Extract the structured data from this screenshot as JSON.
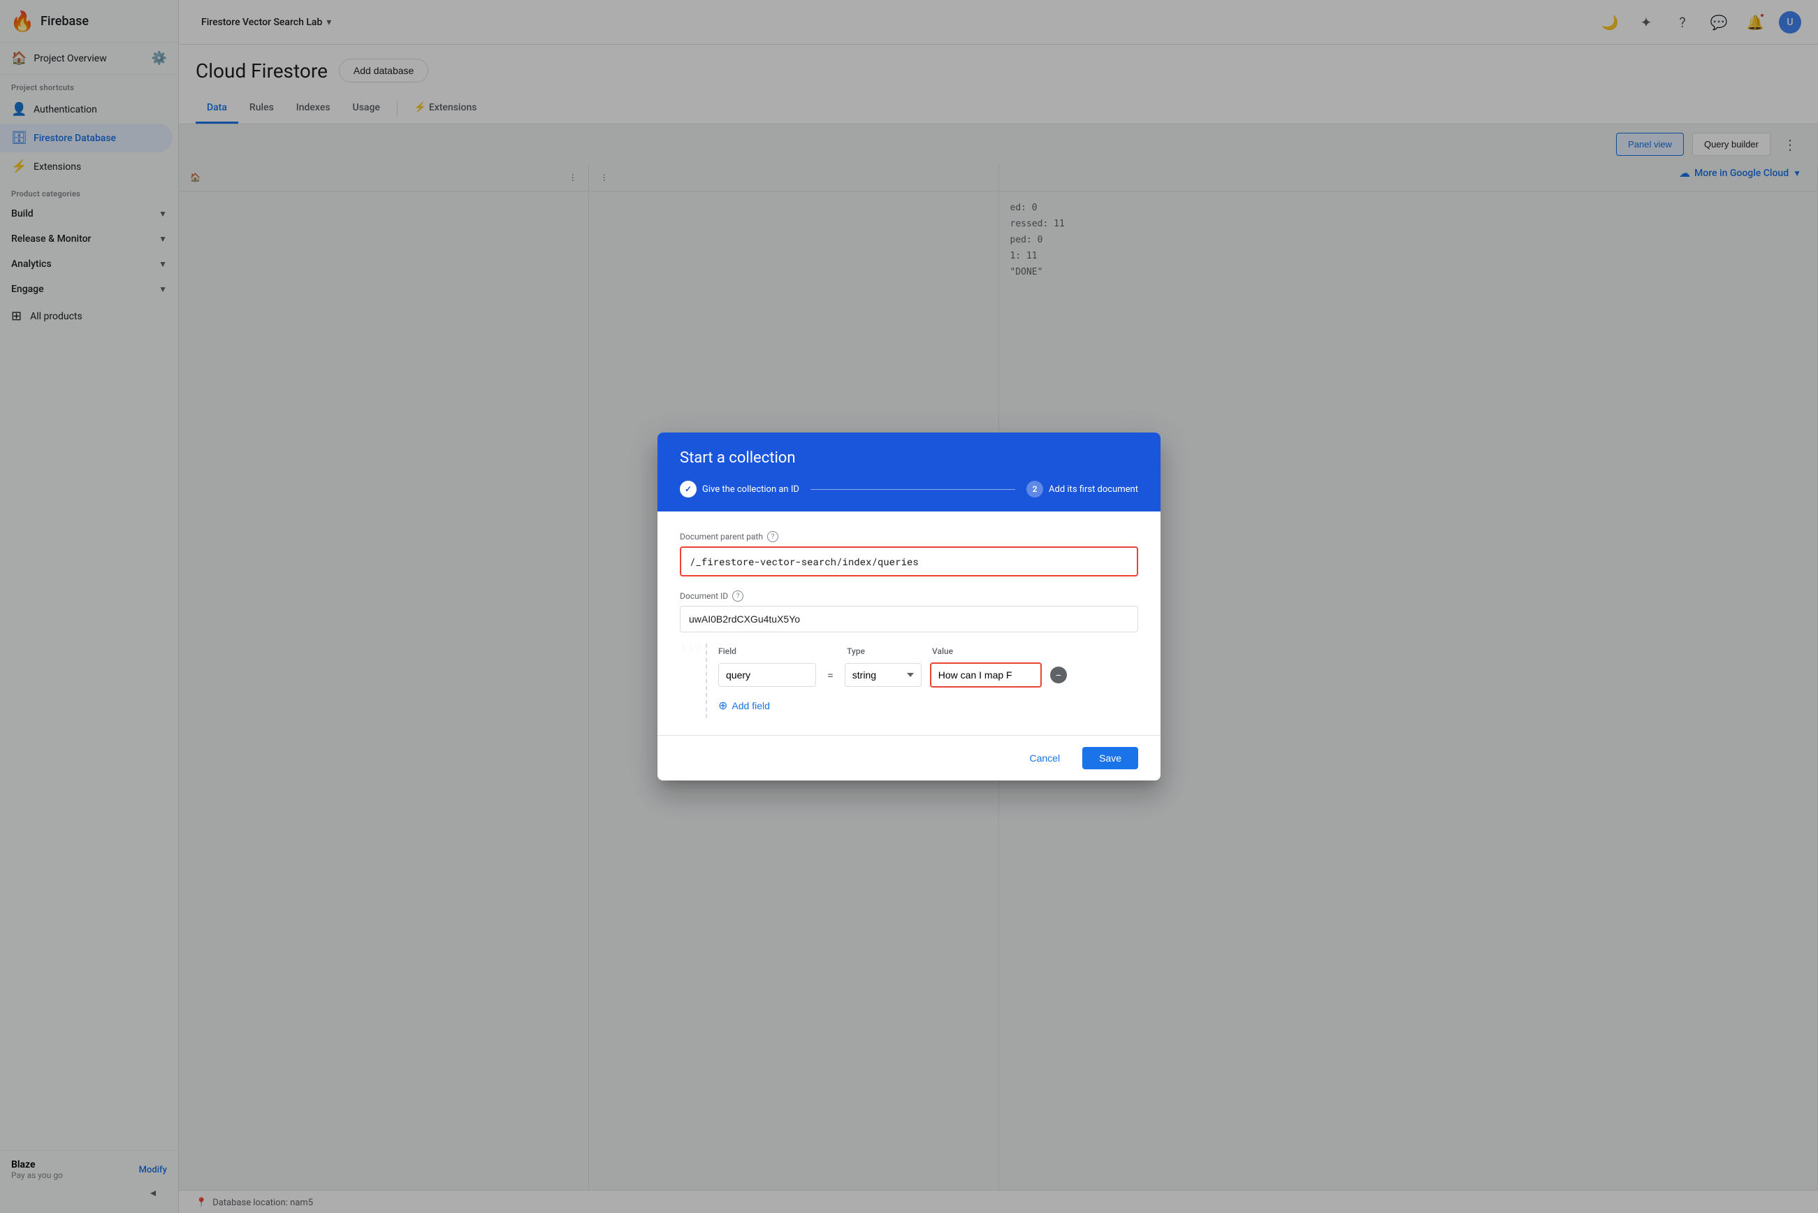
{
  "app": {
    "name": "Firebase"
  },
  "topbar": {
    "project_name": "Firestore Vector Search Lab",
    "dropdown_icon": "▾"
  },
  "sidebar": {
    "project_overview_label": "Project Overview",
    "section_shortcuts": "Project shortcuts",
    "items": [
      {
        "id": "authentication",
        "label": "Authentication",
        "icon": "👤"
      },
      {
        "id": "firestore-database",
        "label": "Firestore Database",
        "icon": "🗄",
        "active": true
      },
      {
        "id": "extensions",
        "label": "Extensions",
        "icon": "⚡"
      }
    ],
    "section_product": "Product categories",
    "categories": [
      {
        "id": "build",
        "label": "Build"
      },
      {
        "id": "release-monitor",
        "label": "Release & Monitor"
      },
      {
        "id": "analytics",
        "label": "Analytics"
      },
      {
        "id": "engage",
        "label": "Engage"
      }
    ],
    "all_products_label": "All products",
    "plan_name": "Blaze",
    "plan_type": "Pay as you go",
    "modify_label": "Modify"
  },
  "page": {
    "title": "Cloud Firestore",
    "add_database_btn": "Add database",
    "tabs": [
      {
        "id": "data",
        "label": "Data",
        "active": true
      },
      {
        "id": "rules",
        "label": "Rules"
      },
      {
        "id": "indexes",
        "label": "Indexes"
      },
      {
        "id": "usage",
        "label": "Usage"
      },
      {
        "id": "extensions",
        "label": "⚡ Extensions"
      }
    ]
  },
  "toolbar": {
    "panel_view_label": "Panel view",
    "query_builder_label": "Query builder",
    "more_in_google_cloud_label": "More in Google Cloud"
  },
  "dialog": {
    "title": "Start a collection",
    "step1_label": "Give the collection an ID",
    "step1_done": true,
    "step2_num": "2",
    "step2_label": "Add its first document",
    "document_parent_path_label": "Document parent path",
    "document_parent_path_value": "/_firestore-vector-search/index/queries",
    "document_id_label": "Document ID",
    "document_id_value": "uwAI0B2rdCXGu4tuX5Yo",
    "field_label": "Field",
    "type_label": "Type",
    "value_label": "Value",
    "field_name": "query",
    "field_type": "string",
    "field_value": "How can I map F",
    "add_field_label": "Add field",
    "cancel_label": "Cancel",
    "save_label": "Save"
  },
  "background": {
    "stats": [
      {
        "label": "ed: 0"
      },
      {
        "label": "ressed: 11"
      },
      {
        "label": "ped: 0"
      },
      {
        "label": "1: 11"
      },
      {
        "label": "\"DONE\""
      }
    ],
    "db_location_label": "Database location: nam5"
  }
}
